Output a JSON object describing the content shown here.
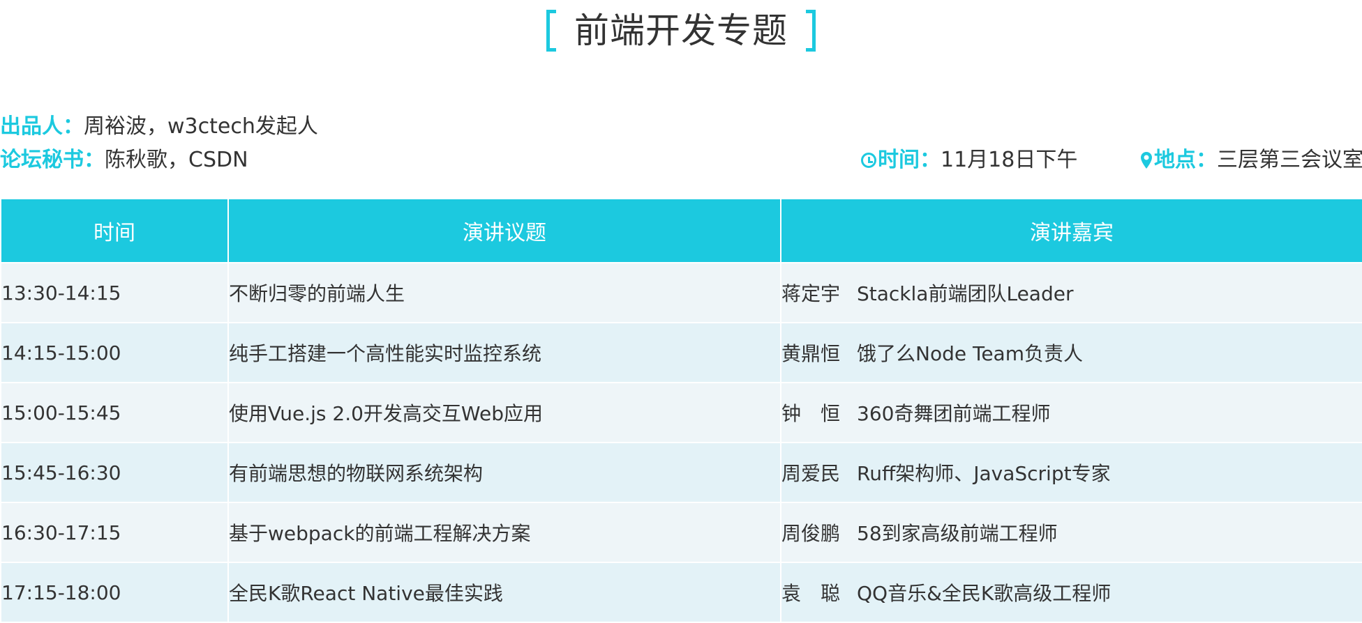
{
  "page": {
    "title": "前端开发专题"
  },
  "info": {
    "producer_label": "出品人：",
    "producer_value": "周裕波，w3ctech发起人",
    "secretary_label": "论坛秘书：",
    "secretary_value": "陈秋歌，CSDN",
    "time_label": "时间：",
    "time_value": "11月18日下午",
    "location_label": "地点：",
    "location_value": "三层第三会议室"
  },
  "table": {
    "headers": [
      "时间",
      "演讲议题",
      "演讲嘉宾"
    ],
    "rows": [
      {
        "time": "13:30-14:15",
        "topic": "不断归零的前端人生",
        "speaker": "蒋定宇",
        "title": "Stackla前端团队Leader"
      },
      {
        "time": "14:15-15:00",
        "topic": "纯手工搭建一个高性能实时监控系统",
        "speaker": "黄鼎恒",
        "title": "饿了么Node Team负责人"
      },
      {
        "time": "15:00-15:45",
        "topic": "使用Vue.js 2.0开发高交互Web应用",
        "speaker": "钟　恒",
        "title": "360奇舞团前端工程师"
      },
      {
        "time": "15:45-16:30",
        "topic": "有前端思想的物联网系统架构",
        "speaker": "周爱民",
        "title": "Ruff架构师、JavaScript专家"
      },
      {
        "time": "16:30-17:15",
        "topic": "基于webpack的前端工程解决方案",
        "speaker": "周俊鹏",
        "title": "58到家高级前端工程师"
      },
      {
        "time": "17:15-18:00",
        "topic": "全民K歌React Native最佳实践",
        "speaker": "袁　聪",
        "title": "QQ音乐&全民K歌高级工程师"
      }
    ]
  },
  "colors": {
    "accent": "#1cc9df",
    "row_odd": "#eef5f8",
    "row_even": "#e3f2f7",
    "text": "#333333"
  },
  "icons": {
    "time": "clock-icon",
    "location": "map-pin-icon"
  }
}
